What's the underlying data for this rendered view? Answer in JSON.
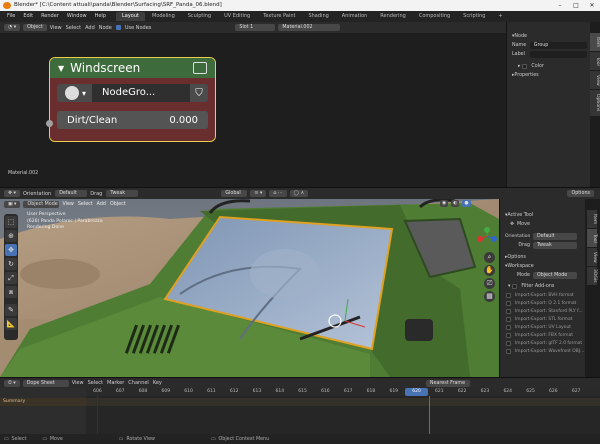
{
  "window": {
    "title": "Blender* [C:\\Content attuali\\panda\\Blender\\Surfacing\\SRF_Panda_06.blend]",
    "minimize": "–",
    "maximize": "□",
    "close": "✕"
  },
  "menu": {
    "items": [
      "File",
      "Edit",
      "Render",
      "Window",
      "Help"
    ],
    "tabs": [
      "Layout",
      "Modeling",
      "Sculpting",
      "UV Editing",
      "Texture Paint",
      "Shading",
      "Animation",
      "Rendering",
      "Compositing",
      "Scripting"
    ],
    "add_tab": "+"
  },
  "node_editor": {
    "header": {
      "editor_type": "Object",
      "items": [
        "View",
        "Select",
        "Add",
        "Node"
      ],
      "use_nodes": "Use Nodes",
      "slot": "Slot 1",
      "material": "Material.002"
    },
    "node": {
      "title": "Windscreen",
      "group": "NodeGro...",
      "input_label": "Dirt/Clean",
      "input_value": "0.000"
    },
    "material_label": "Material.002"
  },
  "node_sidebar": {
    "section": "Node",
    "name_label": "Name",
    "name_value": "Group",
    "label_label": "Label",
    "color_label": "Color",
    "properties_label": "Properties",
    "tabs": [
      "Item",
      "Tool",
      "View",
      "Options"
    ]
  },
  "mid_header": {
    "orientation_label": "Orientation",
    "orientation_value": "Default",
    "drag_label": "Drag",
    "drag_value": "Tweak",
    "global": "Global",
    "options": "Options"
  },
  "viewport": {
    "header": {
      "mode": "Object Mode",
      "items": [
        "View",
        "Select",
        "Add",
        "Object"
      ]
    },
    "overlay": {
      "line1": "User Perspective",
      "line2": "(626) Panda Polarec | Parabrezza",
      "line3": "Rendering Done"
    }
  },
  "viewport_sidebar": {
    "active_tool": "Active Tool",
    "move": "Move",
    "orientation_label": "Orientation",
    "orientation_value": "Default",
    "drag_label": "Drag",
    "drag_value": "Tweak",
    "options": "Options",
    "workspace": "Workspace",
    "mode_label": "Mode",
    "mode_value": "Object Mode",
    "filter_addons": "Filter Add-ons",
    "addons": [
      "Import-Export: BVH format",
      "Import-Export: Q 2.1 format",
      "Import-Export: Stanford PLY f...",
      "Import-Export: STL format",
      "Import-Export: UV Layout",
      "Import-Export: FBX format",
      "Import-Export: glTF 2.0 format",
      "Import-Export: Wavefront OBJ..."
    ],
    "tabs": [
      "Item",
      "Tool",
      "View",
      "3DGis"
    ]
  },
  "dopesheet": {
    "editor": "Dope Sheet",
    "items": [
      "View",
      "Select",
      "Marker",
      "Channel",
      "Key"
    ],
    "nearest_frame": "Nearest Frame",
    "summary": "Summary",
    "frames": [
      "606",
      "607",
      "608",
      "609",
      "610",
      "611",
      "612",
      "613",
      "614",
      "615",
      "616",
      "617",
      "618",
      "619",
      "620",
      "621",
      "622",
      "623",
      "624",
      "625",
      "626",
      "627"
    ],
    "current_frame": "620"
  },
  "status": {
    "items": [
      "Select",
      "Move",
      "Rotate View",
      "Object Context Menu"
    ]
  },
  "colors": {
    "accent": "#4772b3",
    "node_header": "#3d6b3c",
    "node_body": "#6b2e2e",
    "node_outline": "#e9cf4b",
    "car_body": "#4f7d34"
  }
}
